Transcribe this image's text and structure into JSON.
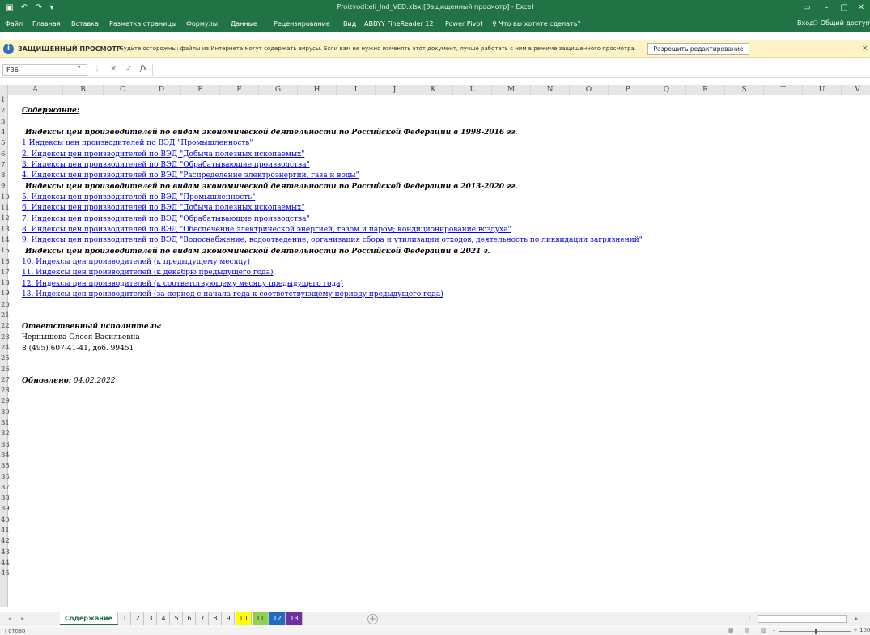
{
  "window": {
    "title": "Proizvoditeli_Ind_VED.xlsx [Защищенный просмотр] - Excel",
    "save_icon": "save-icon",
    "undo_icon": "undo-icon",
    "redo_icon": "redo-icon"
  },
  "menu": {
    "tabs": [
      "Файл",
      "Главная",
      "Вставка",
      "Разметка страницы",
      "Формулы",
      "Данные",
      "Рецензирование",
      "Вид",
      "ABBYY FineReader 12",
      "Power Pivot"
    ],
    "search": "Что вы хотите сделать?",
    "login": "Вход",
    "share": "Общий доступ"
  },
  "protected_view": {
    "title": "ЗАЩИЩЕННЫЙ ПРОСМОТР",
    "message": "Будьте осторожны: файлы из Интернета могут содержать вирусы. Если вам не нужно изменять этот документ, лучше работать с ним в режиме защищенного просмотра.",
    "button": "Разрешить редактирование",
    "close": "×"
  },
  "formula_bar": {
    "cell_ref": "F36",
    "fx": "fx",
    "value": ""
  },
  "columns": [
    "A",
    "B",
    "C",
    "D",
    "E",
    "F",
    "G",
    "H",
    "I",
    "J",
    "K",
    "L",
    "M",
    "N",
    "O",
    "P",
    "Q",
    "R",
    "S",
    "T",
    "U",
    "V"
  ],
  "rows": [
    "1",
    "2",
    "3",
    "4",
    "5",
    "6",
    "7",
    "8",
    "9",
    "10",
    "11",
    "12",
    "13",
    "14",
    "15",
    "16",
    "17",
    "18",
    "19",
    "20",
    "21",
    "22",
    "23",
    "24",
    "25",
    "26",
    "27",
    "28",
    "29",
    "30",
    "31",
    "32",
    "33",
    "34",
    "35",
    "36",
    "37",
    "38",
    "39",
    "40",
    "41",
    "42",
    "43",
    "44",
    "45"
  ],
  "content": {
    "r2": "Содержание:",
    "r4": "Индексы цен производителей по видам экономической деятельности по Российской Федерации в 1998-2016 гг.",
    "r5": "1 Индексы цен производителей по ВЭД \"Промышленность\"",
    "r6": "2. Индексы цен производителей по ВЭД \"Добыча полезных ископаемых\"",
    "r7": "3. Индексы цен производителей по ВЭД \"Обрабатывающие производства\"",
    "r8": "4. Индексы цен производителей по ВЭД \"Распределение электроэнергии, газа и воды\"",
    "r9": "Индексы цен производителей по видам экономической деятельности по Российской Федерации в 2013-2020 гг.",
    "r10": "5. Индексы цен производителей по ВЭД \"Промышленность\"",
    "r11": "6. Индексы цен производителей по ВЭД \"Добыча полезных ископаемых\"",
    "r12": "7. Индексы цен производителей по ВЭД \"Обрабатывающие производства\"",
    "r13": "8. Индексы цен производителей по ВЭД \"Обеспечение электрической энергией, газом и паром; кондиционирование воздуха\"",
    "r14": "9. Индексы цен производителей по ВЭД \"Водоснабжение; водоотведение, организация сбора и утилизации отходов, деятельность по ликвидации загрязнений\"",
    "r15": "Индексы цен производителей по видам экономической деятельности по Российской Федерации в 2021 г.",
    "r16": "10. Индексы цен производителей (к предыдущему месяцу)",
    "r17": "11. Индексы цен производителей (к декабрю предыдущего года)",
    "r18": "12. Индексы цен производителей (к соответствующему месяцу предыдущего года)",
    "r19": "13. Индексы цен производителей (за период с начала года к соответствующему периоду предыдущего года)",
    "r22": "Ответственный исполнитель:",
    "r23": "Чернышова Олеся Васильевна",
    "r24": "8 (495) 607-41-41, доб. 99451",
    "r27_label": "Обновлено:",
    "r27_value": "04.02.2022"
  },
  "sheet_tabs": [
    {
      "label": "Содержание",
      "color": "#ffffff"
    },
    {
      "label": "1",
      "color": "#f0f0f0"
    },
    {
      "label": "2",
      "color": "#f0f0f0"
    },
    {
      "label": "3",
      "color": "#f0f0f0"
    },
    {
      "label": "4",
      "color": "#f0f0f0"
    },
    {
      "label": "5",
      "color": "#f0f0f0"
    },
    {
      "label": "6",
      "color": "#f0f0f0"
    },
    {
      "label": "7",
      "color": "#f0f0f0"
    },
    {
      "label": "8",
      "color": "#f0f0f0"
    },
    {
      "label": "9",
      "color": "#f0f0f0"
    },
    {
      "label": "10",
      "color": "#ffff00"
    },
    {
      "label": "11",
      "color": "#92d050"
    },
    {
      "label": "12",
      "color": "#1f6dc0"
    },
    {
      "label": "13",
      "color": "#7030a0"
    }
  ],
  "status": {
    "text": "Готово",
    "zoom": "100"
  },
  "colors": {
    "excel_green": "#217346",
    "link_blue": "#0000ee"
  }
}
